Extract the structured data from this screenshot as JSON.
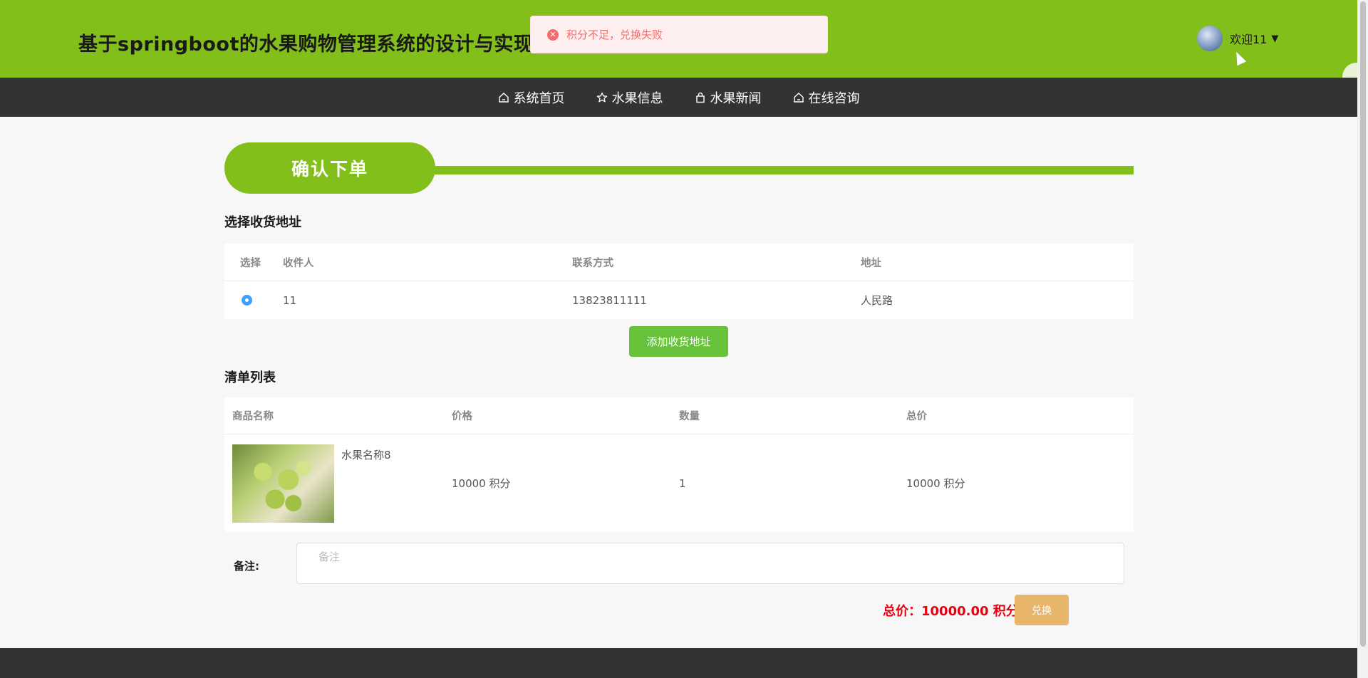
{
  "header": {
    "site_title": "基于springboot的水果购物管理系统的设计与实现",
    "welcome": "欢迎11",
    "caret": "▼"
  },
  "toast": {
    "icon": "✕",
    "message": "积分不足，兑换失败",
    "type": "error"
  },
  "nav": {
    "items": [
      {
        "label": "系统首页",
        "icon": "home-icon"
      },
      {
        "label": "水果信息",
        "icon": "star-icon"
      },
      {
        "label": "水果新闻",
        "icon": "bag-icon"
      },
      {
        "label": "在线咨询",
        "icon": "home-icon"
      }
    ]
  },
  "banner": {
    "title": "确认下单"
  },
  "address": {
    "section_title": "选择收货地址",
    "columns": [
      "选择",
      "收件人",
      "联系方式",
      "地址"
    ],
    "rows": [
      {
        "selected": true,
        "recipient": "11",
        "phone": "13823811111",
        "address": "人民路"
      }
    ],
    "add_button": "添加收货地址"
  },
  "items": {
    "section_title": "清单列表",
    "columns": [
      "商品名称",
      "价格",
      "数量",
      "总价"
    ],
    "rows": [
      {
        "name": "水果名称8",
        "price": "10000 积分",
        "quantity": "1",
        "total": "10000 积分"
      }
    ]
  },
  "remark": {
    "label": "备注:",
    "placeholder": "备注",
    "value": ""
  },
  "summary": {
    "total_text": "总价：10000.00 积分",
    "exchange_button": "兑换"
  },
  "colors": {
    "brand_green": "#82bf1a",
    "nav_dark": "#333333",
    "add_button": "#67c23a",
    "exchange_button": "#e8b66a",
    "total_red": "#e60012",
    "error": "#f56c6c"
  }
}
